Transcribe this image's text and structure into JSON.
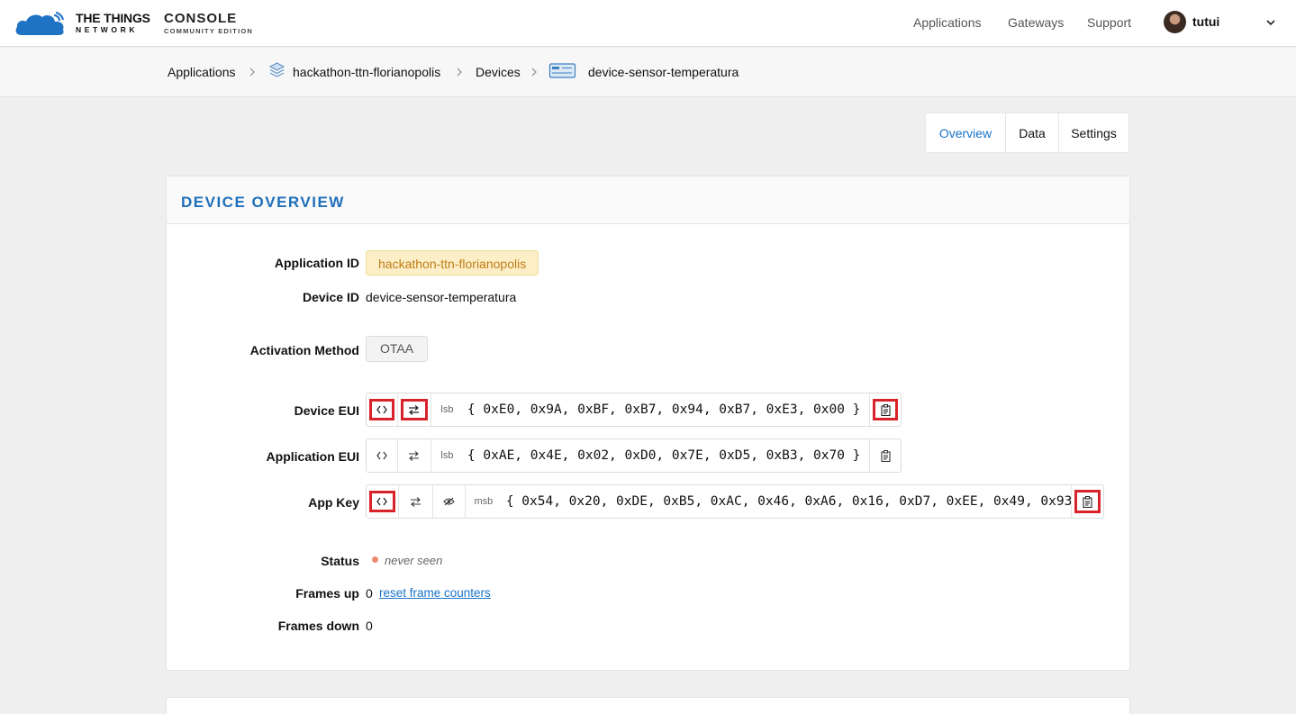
{
  "header": {
    "brand_line1": "THE THINGS",
    "brand_line2": "NETWORK",
    "console_title": "CONSOLE",
    "console_subtitle": "COMMUNITY EDITION",
    "nav": [
      "Applications",
      "Gateways",
      "Support"
    ],
    "username": "tutui"
  },
  "breadcrumb": {
    "items": [
      "Applications",
      "hackathon-ttn-florianopolis",
      "Devices",
      "device-sensor-temperatura"
    ]
  },
  "tabs": [
    {
      "label": "Overview",
      "active": true
    },
    {
      "label": "Data",
      "active": false
    },
    {
      "label": "Settings",
      "active": false
    }
  ],
  "device_overview": {
    "title": "DEVICE OVERVIEW",
    "application_id_label": "Application ID",
    "application_id": "hackathon-ttn-florianopolis",
    "device_id_label": "Device ID",
    "device_id": "device-sensor-temperatura",
    "activation_method_label": "Activation Method",
    "activation_method": "OTAA",
    "device_eui_label": "Device EUI",
    "device_eui_order": "lsb",
    "device_eui": "{ 0xE0, 0x9A, 0xBF, 0xB7, 0x94, 0xB7, 0xE3, 0x00 }",
    "application_eui_label": "Application EUI",
    "application_eui_order": "lsb",
    "application_eui": "{ 0xAE, 0x4E, 0x02, 0xD0, 0x7E, 0xD5, 0xB3, 0x70 }",
    "app_key_label": "App Key",
    "app_key_order": "msb",
    "app_key": "{ 0x54, 0x20, 0xDE, 0xB5, 0xAC, 0x46, 0xA6, 0x16, 0xD7, 0xEE, 0x49, 0x93,",
    "status_label": "Status",
    "status": "never seen",
    "frames_up_label": "Frames up",
    "frames_up": "0",
    "reset_link": "reset frame counters",
    "frames_down_label": "Frames down",
    "frames_down": "0"
  },
  "colors": {
    "accent": "#1a73c9",
    "title_blue": "#1f6fba",
    "highlight_red": "#d9232a",
    "status_dot": "#ef8a72"
  }
}
